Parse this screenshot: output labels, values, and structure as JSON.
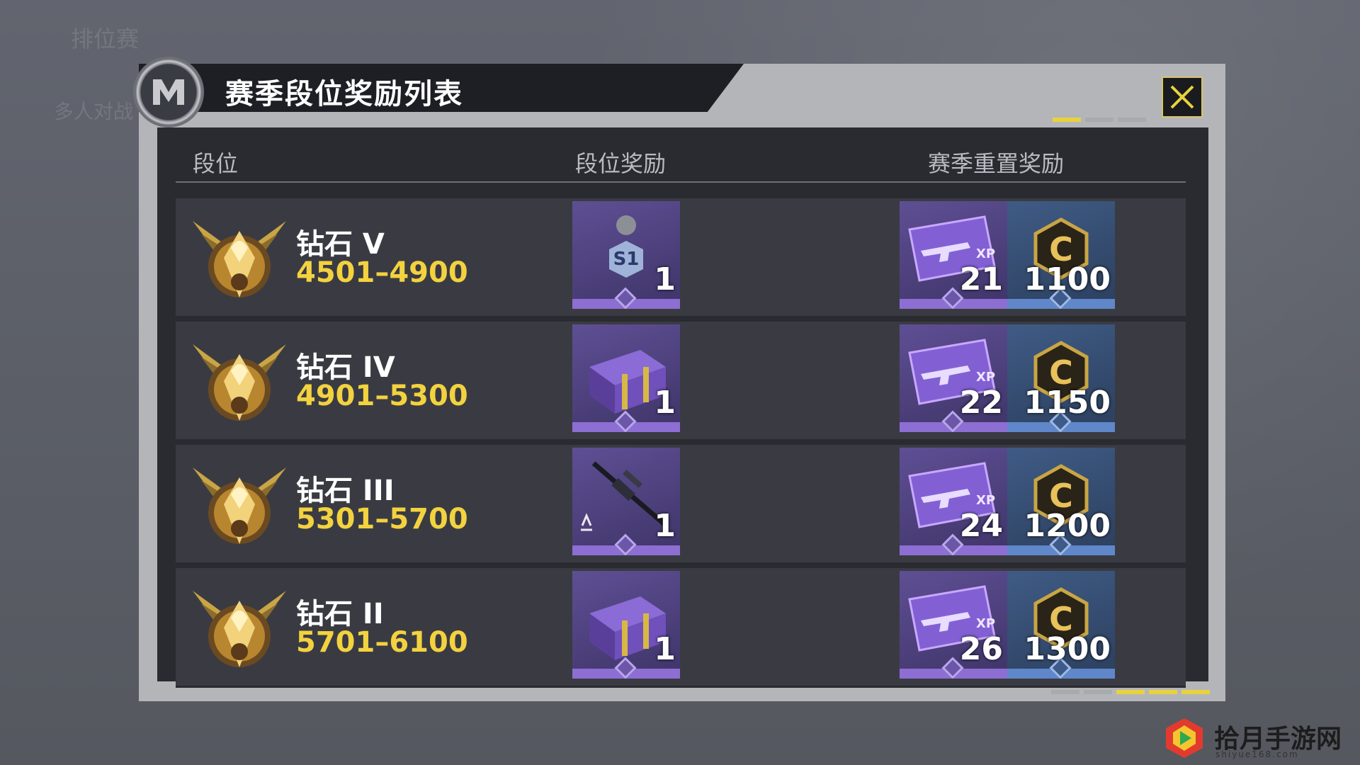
{
  "title": "赛季段位奖励列表",
  "headers": {
    "rank": "段位",
    "rank_reward": "段位奖励",
    "season_reward": "赛季重置奖励"
  },
  "background": {
    "tab": "排位赛",
    "mode": "多人对战"
  },
  "pager_top": {
    "pages": 3,
    "current": 1
  },
  "pager_bottom": {
    "pages": 5,
    "active": [
      3,
      4,
      5
    ]
  },
  "rows": [
    {
      "name": "钻石 V",
      "range": "4501–4900",
      "rank_reward": {
        "icon": "season-1-badge-icon",
        "qty": "1"
      },
      "xp_card": {
        "icon": "weapon-xp-card-icon",
        "qty": "21"
      },
      "credits": {
        "icon": "cod-credit-icon",
        "qty": "1100"
      }
    },
    {
      "name": "钻石 IV",
      "range": "4901–5300",
      "rank_reward": {
        "icon": "supply-crate-icon",
        "qty": "1"
      },
      "xp_card": {
        "icon": "weapon-xp-card-icon",
        "qty": "22"
      },
      "credits": {
        "icon": "cod-credit-icon",
        "qty": "1150"
      }
    },
    {
      "name": "钻石 III",
      "range": "5301–5700",
      "rank_reward": {
        "icon": "sniper-rifle-icon",
        "qty": "1"
      },
      "xp_card": {
        "icon": "weapon-xp-card-icon",
        "qty": "24"
      },
      "credits": {
        "icon": "cod-credit-icon",
        "qty": "1200"
      }
    },
    {
      "name": "钻石 II",
      "range": "5701–6100",
      "rank_reward": {
        "icon": "supply-crate-icon",
        "qty": "1"
      },
      "xp_card": {
        "icon": "weapon-xp-card-icon",
        "qty": "26"
      },
      "credits": {
        "icon": "cod-credit-icon",
        "qty": "1300"
      }
    }
  ],
  "watermark": {
    "text": "拾月手游网",
    "sub": "shiyue168.com"
  },
  "colors": {
    "accent_yellow": "#f3d23f",
    "panel": "#2a2b31",
    "row": "#3a3b42",
    "purple_tile": "#4b3f7a",
    "blue_tile": "#2c3f5e"
  }
}
